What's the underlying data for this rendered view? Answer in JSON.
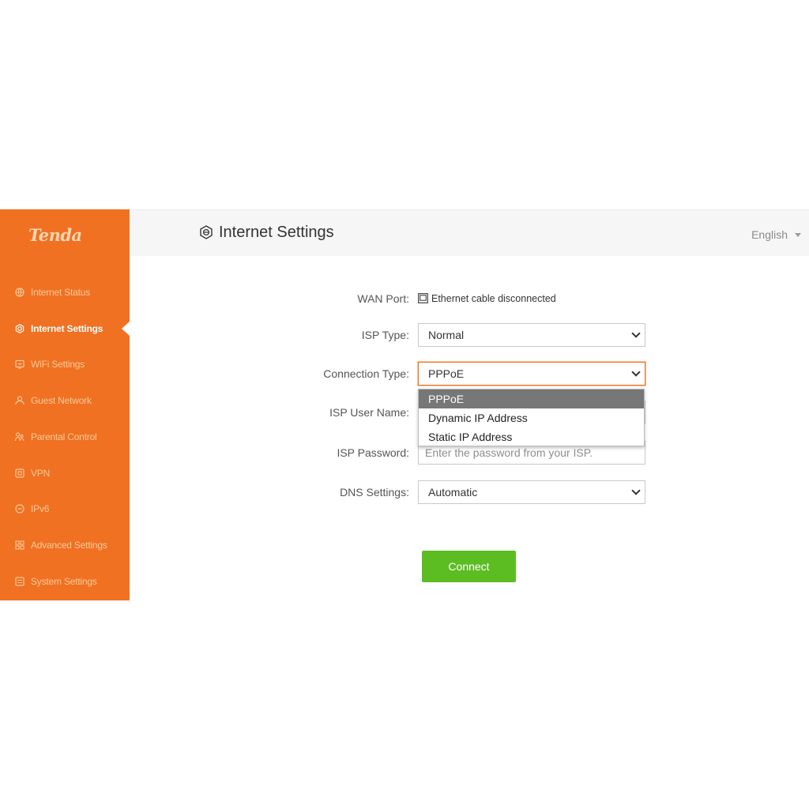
{
  "brand": {
    "logo_text": "Tenda",
    "accent": "#f07122",
    "button_color": "#5cbd22"
  },
  "sidebar": {
    "items": [
      {
        "label": "Internet Status",
        "icon": "globe-icon"
      },
      {
        "label": "Internet Settings",
        "icon": "internet-settings-icon",
        "active": true
      },
      {
        "label": "WiFi Settings",
        "icon": "wifi-settings-icon"
      },
      {
        "label": "Guest Network",
        "icon": "guest-user-icon"
      },
      {
        "label": "Parental Control",
        "icon": "parental-icon"
      },
      {
        "label": "VPN",
        "icon": "vpn-icon"
      },
      {
        "label": "IPv6",
        "icon": "ipv6-icon"
      },
      {
        "label": "Advanced Settings",
        "icon": "grid-icon"
      },
      {
        "label": "System Settings",
        "icon": "system-icon"
      }
    ]
  },
  "header": {
    "title": "Internet Settings",
    "title_icon": "internet-settings-icon",
    "language": "English"
  },
  "form": {
    "wan_port": {
      "label": "WAN Port:",
      "value": "Ethernet cable disconnected",
      "icon": "ethernet-port-icon"
    },
    "isp_type": {
      "label": "ISP Type:",
      "value": "Normal"
    },
    "connection_type": {
      "label": "Connection Type:",
      "value": "PPPoE",
      "options": [
        "PPPoE",
        "Dynamic IP Address",
        "Static IP Address"
      ],
      "selected_index": 0
    },
    "isp_user_name": {
      "label": "ISP User Name:",
      "value": ""
    },
    "isp_password": {
      "label": "ISP Password:",
      "placeholder": "Enter the password from your ISP."
    },
    "dns_settings": {
      "label": "DNS Settings:",
      "value": "Automatic"
    }
  },
  "actions": {
    "connect_label": "Connect"
  }
}
